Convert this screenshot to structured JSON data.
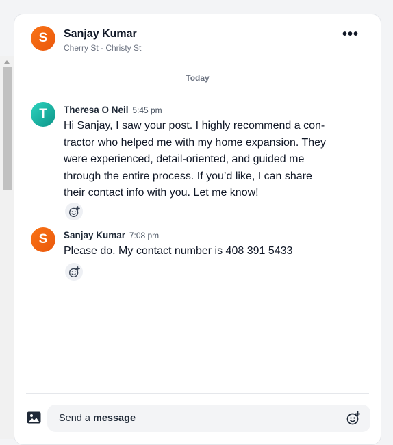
{
  "header": {
    "avatar_letter": "S",
    "name": "Sanjay Kumar",
    "subtitle": "Cherry St - Christy St",
    "more_icon": "more-horizontal-icon"
  },
  "day_separator": "Today",
  "messages": [
    {
      "avatar_letter": "T",
      "sender": "Theresa O Neil",
      "time": "5:45 pm",
      "text": "Hi Sanjay, I saw your post. I highly recommend a con­tractor who helped me with my home expansion. They were experienced, detail-oriented, and guided me through the entire process. If you’d like, I can share their contact info with you. Let me know!"
    },
    {
      "avatar_letter": "S",
      "sender": "Sanjay Kumar",
      "time": "7:08 pm",
      "text": "Please do. My contact number is 408 391 5433"
    }
  ],
  "composer": {
    "placeholder_prefix": "Send a",
    "placeholder_bold": "message",
    "attach_icon": "image-icon",
    "emoji_icon": "add-emoji-icon"
  },
  "colors": {
    "avatar_s": "#f97316",
    "avatar_t": "#14b8a6"
  }
}
